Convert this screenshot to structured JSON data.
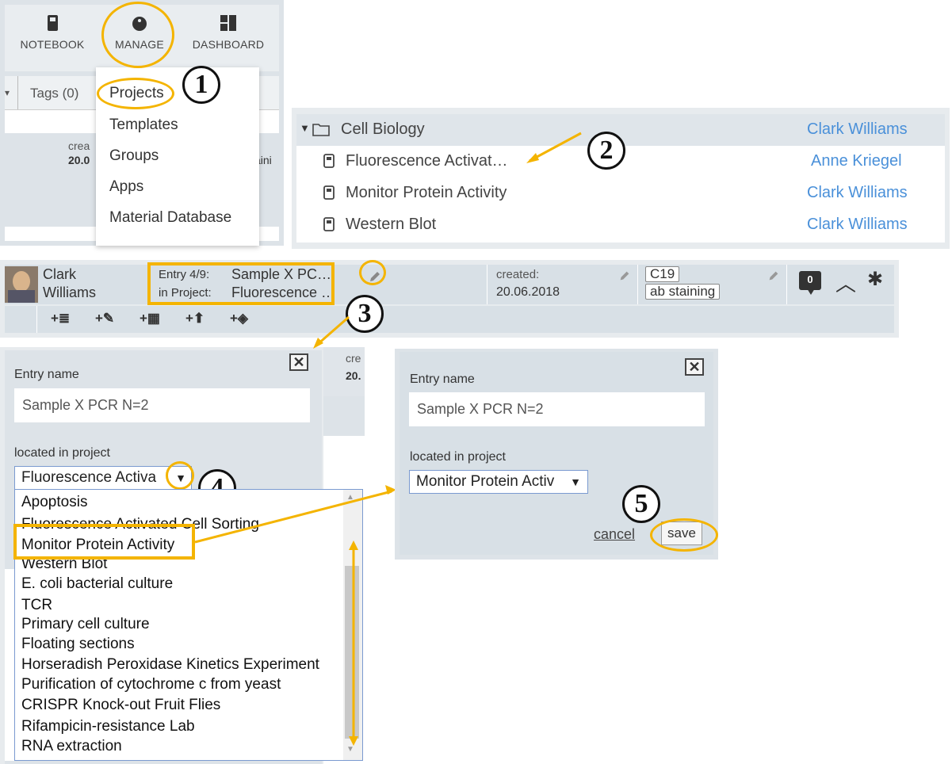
{
  "nav": {
    "notebook": "NOTEBOOK",
    "manage": "MANAGE",
    "dashboard": "DASHBOARD",
    "tags": "Tags (0)",
    "frag1": "crea",
    "frag2": "20.0",
    "frag3": "aini"
  },
  "manage_menu": {
    "items": [
      "Projects",
      "Templates",
      "Groups",
      "Apps",
      "Material Database"
    ]
  },
  "project_tree": {
    "folder": {
      "name": "Cell Biology",
      "owner": "Clark Williams"
    },
    "items": [
      {
        "name": "Fluorescence Activat…",
        "owner": "Anne Kriegel"
      },
      {
        "name": "Monitor Protein Activity",
        "owner": "Clark Williams"
      },
      {
        "name": "Western Blot",
        "owner": "Clark Williams"
      }
    ]
  },
  "entry_header": {
    "user_first": "Clark",
    "user_last": "Williams",
    "entry_label": "Entry 4/9:",
    "entry_value": "Sample X PC…",
    "project_label": "in Project:",
    "project_value": "Fluorescence …",
    "created_label": "created:",
    "created_value": "20.06.2018",
    "tag1": "C19",
    "tag2": "ab staining",
    "comments": "0"
  },
  "dialog_left": {
    "entry_name_label": "Entry name",
    "entry_name_value": "Sample X PCR N=2",
    "project_label": "located in project",
    "project_value": "Fluorescence Activa",
    "bg_frag1": "cre",
    "bg_frag2": "20."
  },
  "dropdown_list": [
    "Apoptosis",
    "Fluorescence Activated Cell Sorting",
    "Monitor Protein Activity",
    "Western Blot",
    "E. coli bacterial culture",
    "TCR",
    "Primary cell culture",
    "Floating sections",
    "Horseradish Peroxidase Kinetics Experiment",
    "Purification of cytochrome c from yeast",
    "CRISPR Knock-out Fruit Flies",
    "Rifampicin-resistance Lab",
    "RNA extraction"
  ],
  "dialog_right": {
    "entry_name_label": "Entry name",
    "entry_name_value": "Sample X PCR N=2",
    "project_label": "located in project",
    "project_value": "Monitor Protein Activ",
    "cancel": "cancel",
    "save": "save"
  },
  "steps": [
    "1",
    "2",
    "3",
    "4",
    "5"
  ],
  "colors": {
    "highlight": "#f4b400",
    "link": "#4a90d9",
    "panel": "#e7ebee"
  }
}
